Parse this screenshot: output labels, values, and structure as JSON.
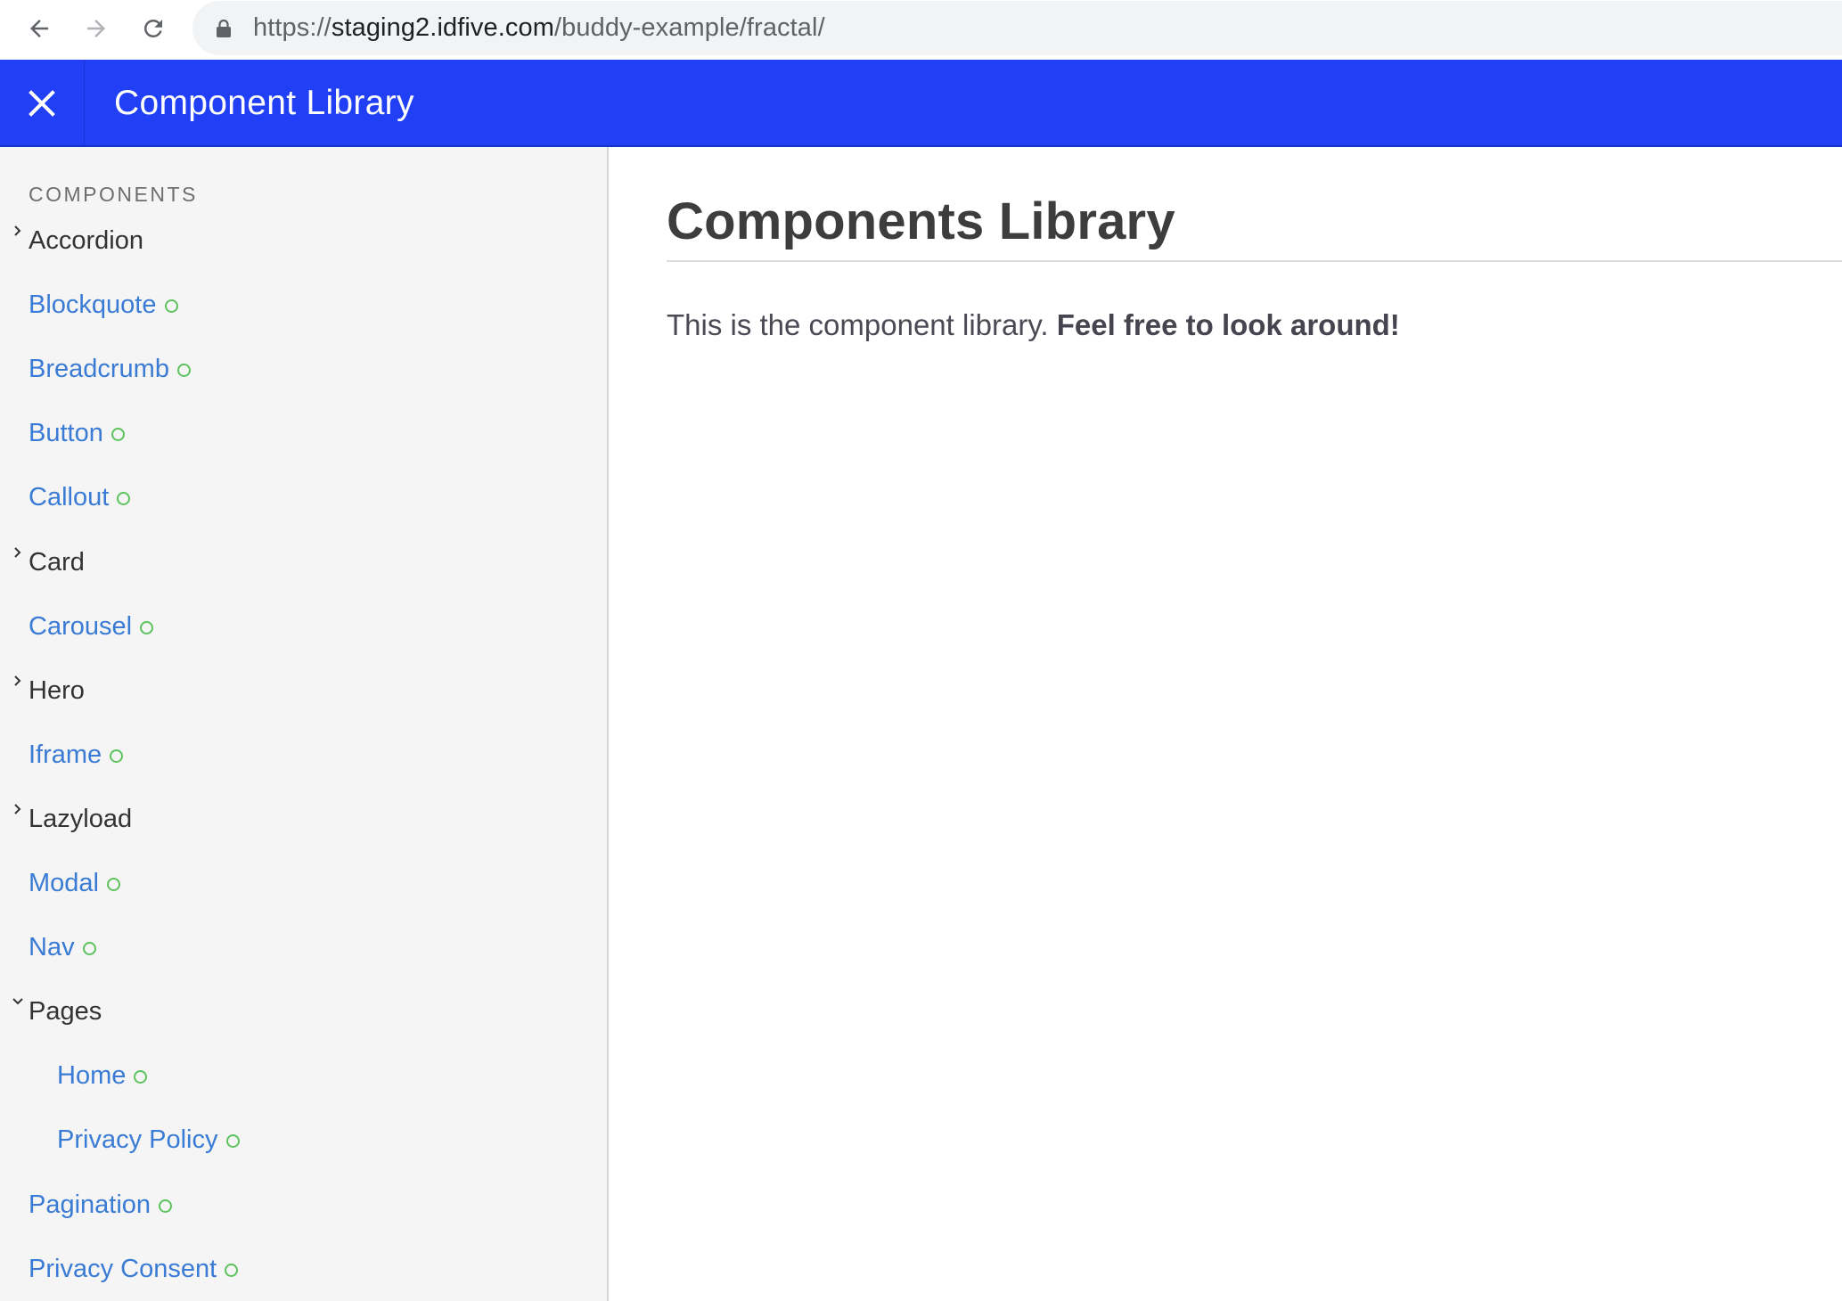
{
  "browser": {
    "url_scheme": "https://",
    "url_host": "staging2.idfive.com",
    "url_path": "/buddy-example/fractal/"
  },
  "header": {
    "title": "Component Library",
    "brand_color": "#2140f5"
  },
  "sidebar": {
    "section_label": "COMPONENTS",
    "link_color": "#3a7bd5",
    "status_color": "#5ec35e",
    "items": [
      {
        "label": "Accordion",
        "type": "collapsed-folder"
      },
      {
        "label": "Blockquote",
        "type": "component"
      },
      {
        "label": "Breadcrumb",
        "type": "component"
      },
      {
        "label": "Button",
        "type": "component"
      },
      {
        "label": "Callout",
        "type": "component"
      },
      {
        "label": "Card",
        "type": "collapsed-folder"
      },
      {
        "label": "Carousel",
        "type": "component"
      },
      {
        "label": "Hero",
        "type": "collapsed-folder"
      },
      {
        "label": "Iframe",
        "type": "component"
      },
      {
        "label": "Lazyload",
        "type": "collapsed-folder"
      },
      {
        "label": "Modal",
        "type": "component"
      },
      {
        "label": "Nav",
        "type": "component"
      },
      {
        "label": "Pages",
        "type": "expanded-folder"
      },
      {
        "label": "Home",
        "type": "component"
      },
      {
        "label": "Privacy Policy",
        "type": "component"
      },
      {
        "label": "Pagination",
        "type": "component"
      },
      {
        "label": "Privacy Consent",
        "type": "component"
      }
    ]
  },
  "main": {
    "title": "Components Library",
    "intro_text": "This is the component library. ",
    "intro_bold": "Feel free to look around!"
  }
}
